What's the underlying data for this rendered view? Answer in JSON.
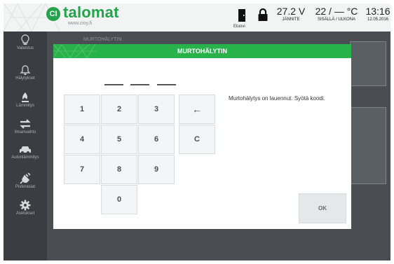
{
  "header": {
    "logo_badge": "CI",
    "logo_text": "talomat",
    "logo_url": "www.cioy.fi",
    "door_label": "Etuovi",
    "voltage": {
      "value": "27.2 V",
      "label": "JÄNNITE"
    },
    "temperature": {
      "value": "22 / — °C",
      "label": "SISÄLLÄ / ULKONA"
    },
    "time": {
      "value": "13:16",
      "date": "12.05.2016"
    }
  },
  "sidebar": {
    "items": [
      {
        "label": "Valaistus",
        "icon": "lightbulb-icon"
      },
      {
        "label": "Hälytykset",
        "icon": "bell-icon"
      },
      {
        "label": "Lämmitys",
        "icon": "flame-icon"
      },
      {
        "label": "Ilmanvaihto",
        "icon": "arrows-icon"
      },
      {
        "label": "Autonlämmitys",
        "icon": "car-icon"
      },
      {
        "label": "Pistorasiat",
        "icon": "plug-icon"
      },
      {
        "label": "Asetukset",
        "icon": "gear-icon"
      }
    ]
  },
  "background": {
    "title_fragment": "MURTOHÄLYTIN"
  },
  "dialog": {
    "title": "MURTOHÄLYTIN",
    "message": "Murtohälytys on lauennut. Syötä koodi.",
    "ok_label": "OK",
    "keys": [
      "1",
      "2",
      "3",
      "←",
      "4",
      "5",
      "6",
      "C",
      "7",
      "8",
      "9",
      "0"
    ]
  },
  "colors": {
    "accent_green": "#27b24a",
    "sidebar_bg": "#3a3d42",
    "header_bg": "#f2f3f3"
  }
}
